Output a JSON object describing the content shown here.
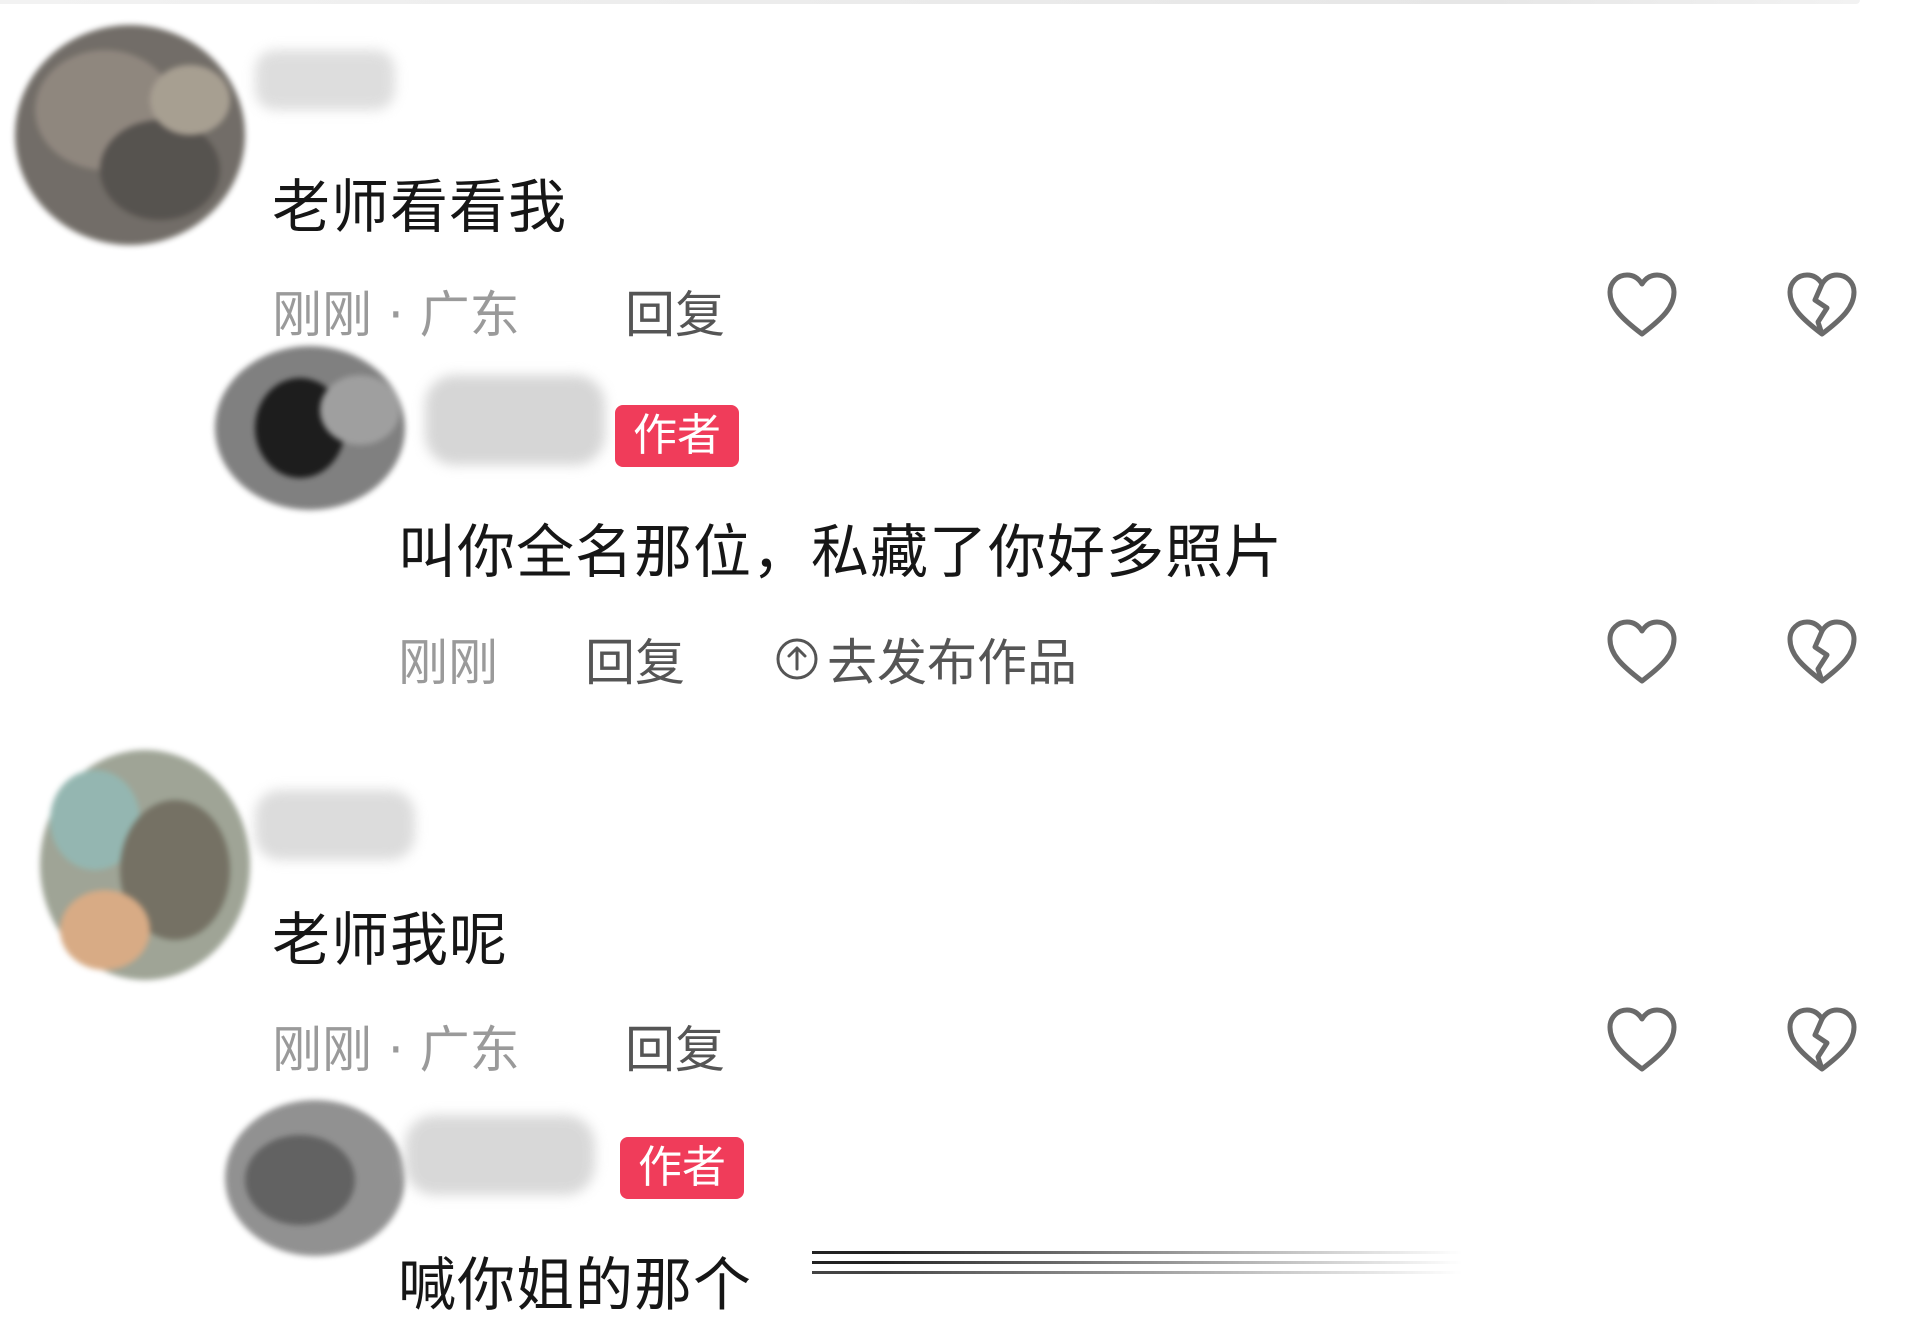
{
  "comments": [
    {
      "text": "老师看看我",
      "meta": "刚刚 · 广东",
      "reply_label": "回复",
      "reply": {
        "badge": "作者",
        "text": "叫你全名那位，私藏了你好多照片",
        "meta": "刚刚",
        "reply_label": "回复",
        "publish_label": "去发布作品"
      }
    },
    {
      "text": "老师我呢",
      "meta": "刚刚 · 广东",
      "reply_label": "回复",
      "reply": {
        "badge": "作者",
        "text": "喊你姐的那个"
      }
    }
  ],
  "icons": {
    "like": "heart-outline-icon",
    "dislike": "broken-heart-icon",
    "publish": "arrow-up-circle-icon"
  },
  "colors": {
    "badge": "#f03c5a",
    "text": "#161616",
    "meta": "#9a9a9a",
    "icon": "#6a6a6a"
  }
}
